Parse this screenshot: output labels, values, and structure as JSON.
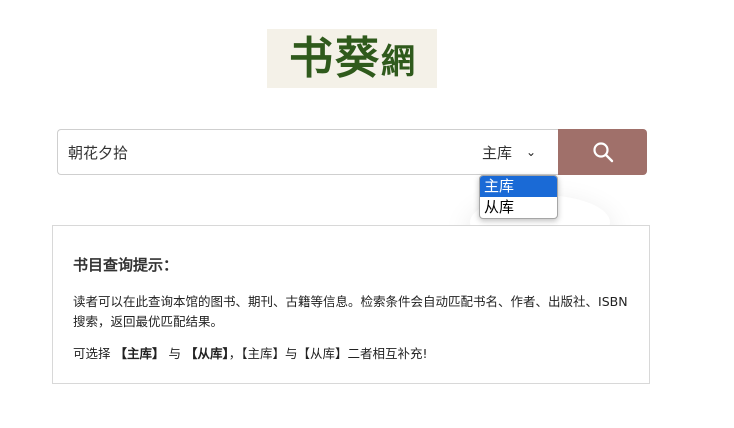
{
  "logo": {
    "char1": "书",
    "char2": "葵",
    "char3": "網"
  },
  "search": {
    "value": "朝花夕拾",
    "placeholder": ""
  },
  "db_select": {
    "selected": "主库",
    "options": [
      "主库",
      "从库"
    ]
  },
  "search_button": {
    "icon": "search-icon"
  },
  "tips": {
    "title": "书目查询提示：",
    "line1": "读者可以在此查询本馆的图书、期刊、古籍等信息。检索条件会自动匹配书名、作者、出版社、ISBN搜索，返回最优匹配结果。",
    "line2_prefix": "可选择 ",
    "line2_main": "【主库】",
    "line2_and": " 与 ",
    "line2_sub": "【从库】",
    "line2_suffix": "，【主库】与【从库】二者相互补充!"
  },
  "colors": {
    "logo_green": "#2f5a1c",
    "button_bg": "#a0706a",
    "option_highlight": "#1a6ad6"
  }
}
